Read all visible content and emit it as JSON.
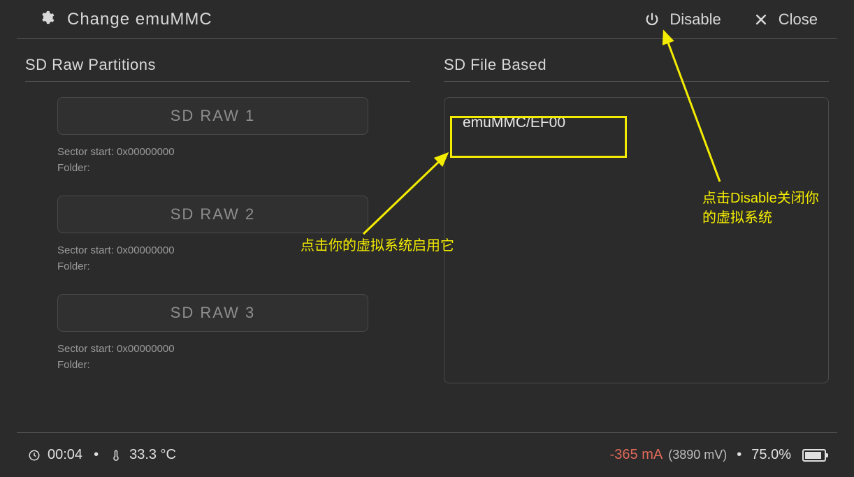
{
  "header": {
    "title": "Change emuMMC",
    "disable_label": "Disable",
    "close_label": "Close"
  },
  "left": {
    "heading": "SD Raw Partitions",
    "items": [
      {
        "label": "SD RAW 1",
        "sector": "Sector start: 0x00000000",
        "folder": "Folder:"
      },
      {
        "label": "SD RAW 2",
        "sector": "Sector start: 0x00000000",
        "folder": "Folder:"
      },
      {
        "label": "SD RAW 3",
        "sector": "Sector start: 0x00000000",
        "folder": "Folder:"
      }
    ]
  },
  "right": {
    "heading": "SD File Based",
    "entry": "emuMMC/EF00"
  },
  "status": {
    "time": "00:04",
    "temp": "33.3 °C",
    "current": "-365 mA",
    "voltage": "(3890 mV)",
    "battery_pct": "75.0%"
  },
  "annot": {
    "enable_hint": "点击你的虚拟系统启用它",
    "disable_hint_l1": "点击Disable关闭你",
    "disable_hint_l2": "的虚拟系统"
  }
}
